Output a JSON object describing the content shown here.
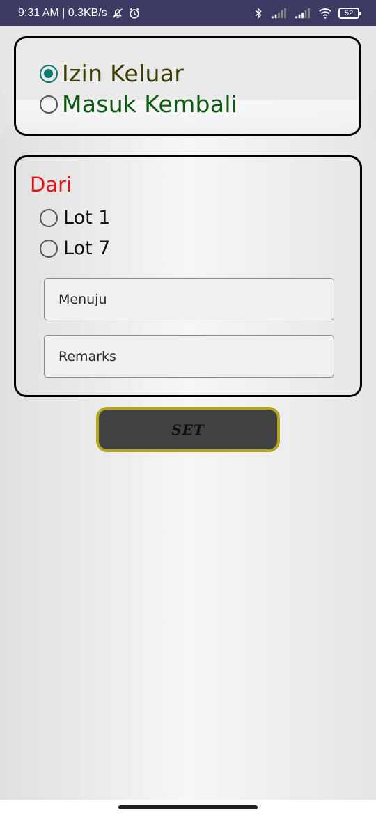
{
  "status_bar": {
    "time_speed": "9:31 AM | 0.3KB/s",
    "battery": "52",
    "icons": [
      "mute-bell-icon",
      "alarm-icon",
      "bluetooth-icon",
      "signal-icon",
      "signal-icon",
      "wifi-icon",
      "battery-icon"
    ]
  },
  "mode": {
    "options": [
      {
        "label": "Izin Keluar",
        "checked": true,
        "color": "#3d3d00"
      },
      {
        "label": "Masuk Kembali",
        "checked": false,
        "color": "#0b5c10"
      }
    ]
  },
  "from": {
    "title": "Dari",
    "title_color": "#e41212",
    "lots": [
      {
        "label": "Lot 1",
        "checked": false
      },
      {
        "label": "Lot 7",
        "checked": false
      }
    ]
  },
  "fields": {
    "destination_placeholder": "Menuju",
    "remarks_placeholder": "Remarks"
  },
  "actions": {
    "set_label": "SET",
    "button_border": "#b3a51d",
    "button_bg": "#424242"
  }
}
